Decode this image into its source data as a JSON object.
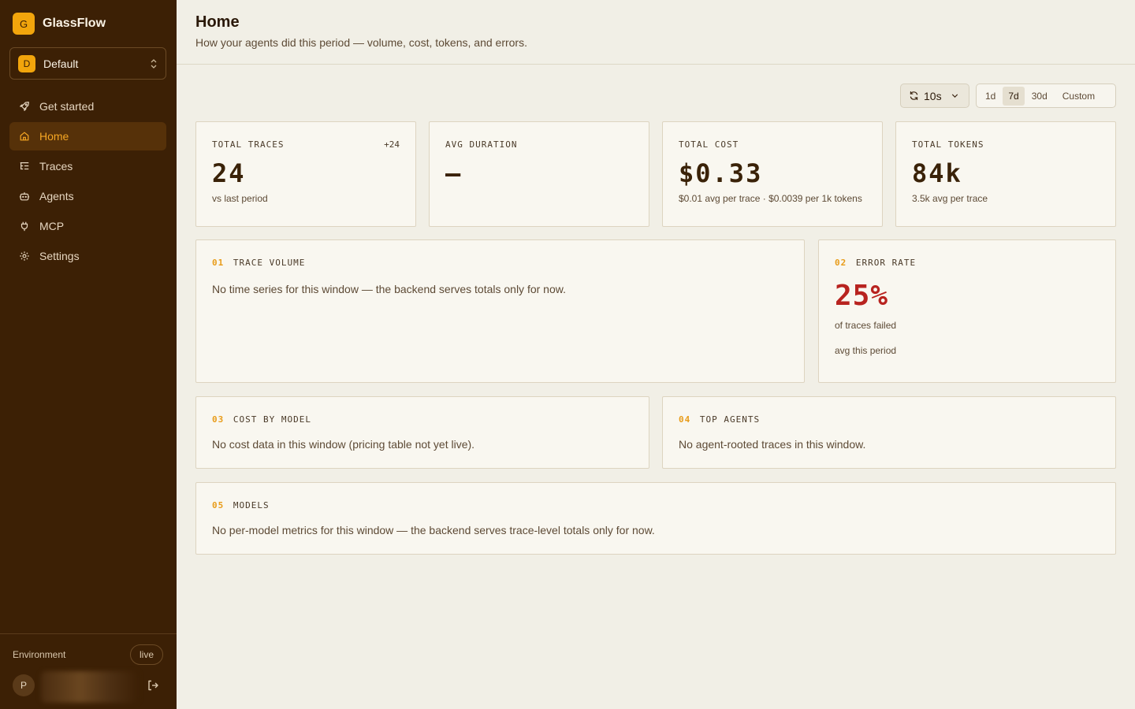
{
  "app": {
    "name": "GlassFlow",
    "logo_letter": "G"
  },
  "workspace": {
    "initial": "D",
    "name": "Default"
  },
  "nav": {
    "items": [
      {
        "label": "Get started",
        "icon": "rocket-icon"
      },
      {
        "label": "Home",
        "icon": "home-icon",
        "active": true
      },
      {
        "label": "Traces",
        "icon": "list-tree-icon"
      },
      {
        "label": "Agents",
        "icon": "bot-icon"
      },
      {
        "label": "MCP",
        "icon": "plug-icon"
      },
      {
        "label": "Settings",
        "icon": "gear-icon"
      }
    ]
  },
  "footer": {
    "environment_label": "Environment",
    "environment_value": "live",
    "user_initial": "P"
  },
  "header": {
    "title": "Home",
    "subtitle": "How your agents did this period — volume, cost, tokens, and errors."
  },
  "controls": {
    "refresh_interval": "10s",
    "ranges": [
      "1d",
      "7d",
      "30d",
      "Custom"
    ],
    "selected_range": "7d"
  },
  "stats": [
    {
      "label": "TOTAL TRACES",
      "delta": "+24",
      "value": "24",
      "sub": "vs last period"
    },
    {
      "label": "AVG DURATION",
      "delta": "",
      "value": "—",
      "sub": ""
    },
    {
      "label": "TOTAL COST",
      "delta": "",
      "value": "$0.33",
      "sub": "$0.01 avg per trace · $0.0039 per 1k tokens"
    },
    {
      "label": "TOTAL TOKENS",
      "delta": "",
      "value": "84k",
      "sub": "3.5k avg per trace"
    }
  ],
  "panels": {
    "trace_volume": {
      "num": "01",
      "label": "TRACE VOLUME",
      "text": "No time series for this window — the backend serves totals only for now."
    },
    "error_rate": {
      "num": "02",
      "label": "ERROR RATE",
      "value": "25%",
      "line1": "of traces failed",
      "line2": "avg this period"
    },
    "cost_by_model": {
      "num": "03",
      "label": "COST BY MODEL",
      "text": "No cost data in this window (pricing table not yet live)."
    },
    "top_agents": {
      "num": "04",
      "label": "TOP AGENTS",
      "text": "No agent-rooted traces in this window."
    },
    "models": {
      "num": "05",
      "label": "MODELS",
      "text": "No per-model metrics for this window — the backend serves trace-level totals only for now."
    }
  },
  "colors": {
    "sidebar_bg": "#3c2005",
    "accent": "#f2a50c",
    "error": "#b8231f",
    "page_bg": "#f1efe6"
  }
}
